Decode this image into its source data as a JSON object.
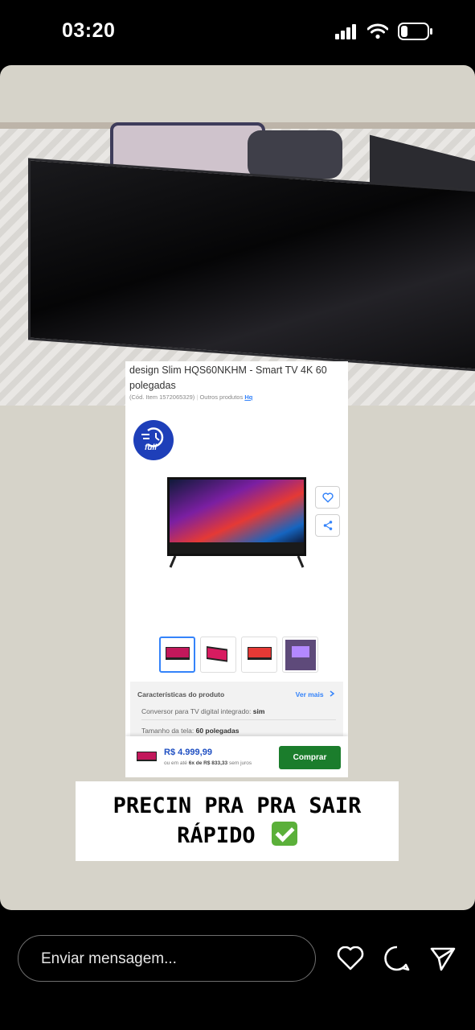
{
  "status_bar": {
    "time": "03:20"
  },
  "product_card": {
    "title": "design Slim HQS60NKHM - Smart TV 4K 60 polegadas",
    "item_code": "(Cód. Item 1572065329)",
    "other_products_label": "Outros produtos",
    "brand": "Hq",
    "full_badge": "full",
    "features": {
      "heading": "Características do produto",
      "see_more": "Ver mais",
      "rows": [
        {
          "label": "Conversor para TV digital integrado:",
          "value": "sim"
        },
        {
          "label": "Tamanho da tela:",
          "value": "60 polegadas"
        }
      ]
    },
    "buy_bar": {
      "price": "R$ 4.999,99",
      "installments_prefix": "ou em até",
      "installments_value": "6x de R$ 833,33",
      "installments_suffix": "sem juros",
      "buy_label": "Comprar"
    },
    "colors": {
      "accent": "#3483fa",
      "buy_button": "#1b7d2c",
      "full_badge": "#1e3fb9",
      "price": "#1f4fc2"
    }
  },
  "caption": {
    "line1": "PRECIN PRA PRA SAIR",
    "line2": "RÁPIDO"
  },
  "reply_bar": {
    "placeholder": "Enviar mensagem..."
  },
  "icons": [
    "signal-icon",
    "wifi-icon",
    "battery-icon",
    "heart-icon",
    "share-icon",
    "comment-icon",
    "send-icon",
    "checkmark-icon"
  ]
}
